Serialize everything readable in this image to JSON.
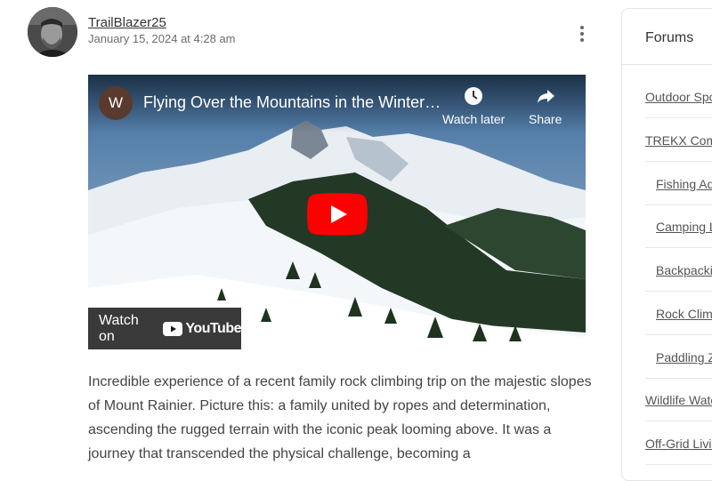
{
  "post": {
    "username": "TrailBlazer25",
    "timestamp": "January 15, 2024 at 4:28 am",
    "more_icon": "vertical-ellipsis-icon",
    "body": "Incredible experience of a recent family rock climbing trip on the majestic slopes of Mount Rainier. Picture this: a family united by ropes and determination, ascending the rugged terrain with the iconic peak looming above. It was a journey that transcended the physical challenge, becoming a"
  },
  "video": {
    "channel_initial": "W",
    "title": "Flying Over the Mountains in the Winter…",
    "watch_later": "Watch later",
    "share": "Share",
    "watch_on": "Watch on",
    "youtube": "YouTube",
    "colors": {
      "play_red": "#ff0000",
      "channel_bg": "#5a3a2e"
    }
  },
  "sidebar": {
    "title": "Forums",
    "items": [
      {
        "label": "Outdoor Sports"
      },
      {
        "label": "TREKX Community"
      },
      {
        "label": "Fishing Adventures"
      },
      {
        "label": "Camping Life"
      },
      {
        "label": "Backpacking"
      },
      {
        "label": "Rock Climbing"
      },
      {
        "label": "Paddling Zone"
      },
      {
        "label": "Wildlife Watching"
      },
      {
        "label": "Off-Grid Living"
      }
    ]
  }
}
